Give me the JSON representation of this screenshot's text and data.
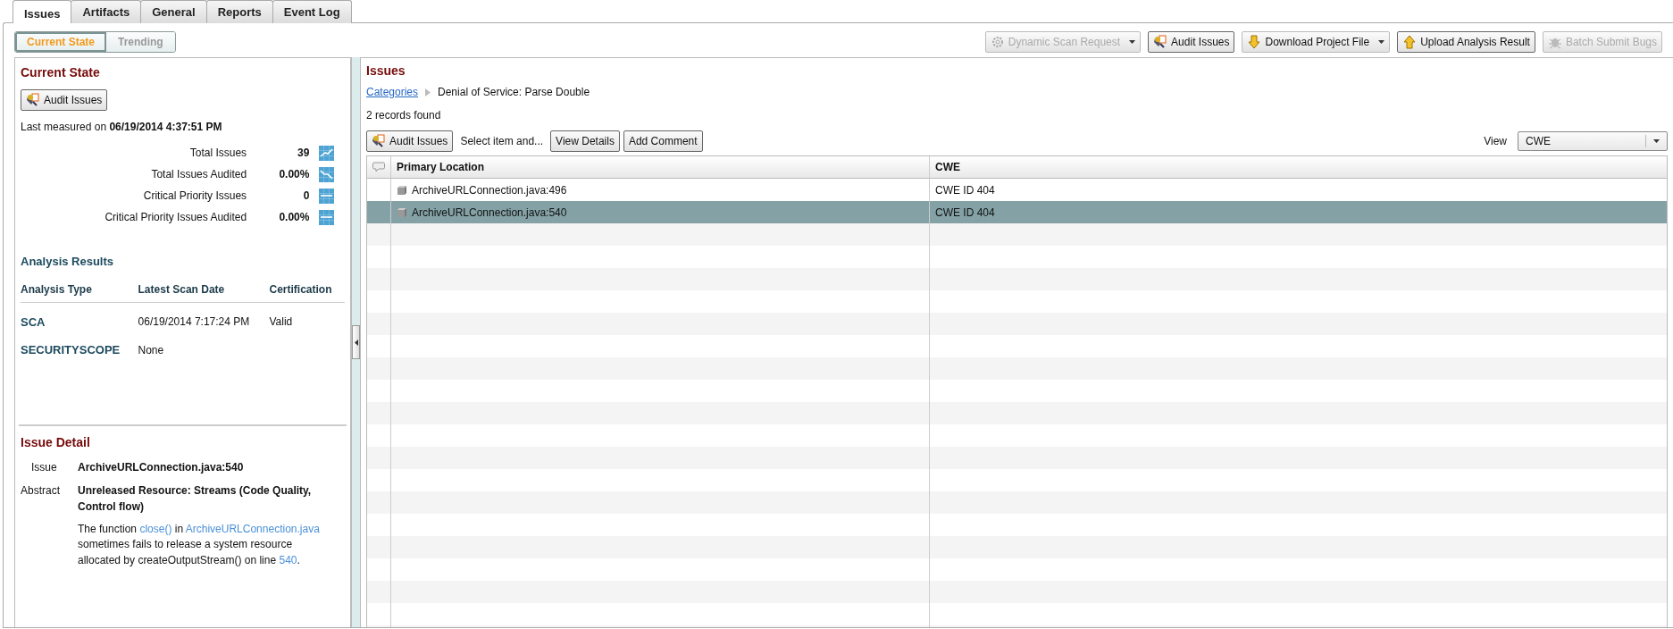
{
  "tabs": [
    {
      "label": "Issues",
      "selected": true
    },
    {
      "label": "Artifacts",
      "selected": false
    },
    {
      "label": "General",
      "selected": false
    },
    {
      "label": "Reports",
      "selected": false
    },
    {
      "label": "Event Log",
      "selected": false
    }
  ],
  "view_toggle": [
    {
      "label": "Current State",
      "selected": true
    },
    {
      "label": "Trending",
      "selected": false
    }
  ],
  "toolbar": [
    {
      "kind": "gear",
      "label": "Dynamic Scan Request",
      "disabled": true,
      "dropdown": true
    },
    {
      "kind": "audit",
      "label": "Audit Issues",
      "disabled": false,
      "dropdown": false
    },
    {
      "kind": "download",
      "label": "Download Project File",
      "disabled": false,
      "dropdown": true
    },
    {
      "kind": "upload",
      "label": "Upload Analysis Result",
      "disabled": false,
      "dropdown": false
    },
    {
      "kind": "bug",
      "label": "Batch Submit Bugs",
      "disabled": true,
      "dropdown": false
    }
  ],
  "current_state": {
    "title": "Current State",
    "audit_button": "Audit Issues",
    "last_measured": "Last measured on **06/19/2014 4:37:51 PM**",
    "metrics": [
      {
        "label": "Total Issues",
        "value": "39",
        "kind": "up"
      },
      {
        "label": "Total Issues Audited",
        "value": "0.00%",
        "kind": "down"
      },
      {
        "label": "Critical Priority Issues",
        "value": "0",
        "kind": "flat"
      },
      {
        "label": "Critical Priority Issues Audited",
        "value": "0.00%",
        "kind": "flat"
      }
    ]
  },
  "analysis_results": {
    "title": "Analysis Results",
    "columns": [
      "Analysis Type",
      "Latest Scan Date",
      "Certification"
    ],
    "rows": [
      [
        "SCA",
        "06/19/2014 7:17:24 PM",
        "Valid"
      ],
      [
        "SECURITYSCOPE",
        "None"
      ]
    ]
  },
  "issue_detail": {
    "title": "Issue Detail",
    "issue_label": "Issue",
    "issue": "ArchiveURLConnection.java:540",
    "abstract_label": "Abstract",
    "abstract": "Unreleased Resource: Streams (Code Quality, Control flow)",
    "description": [
      {
        "text": "The function ",
        "link": false
      },
      {
        "text": "close()",
        "link": true
      },
      {
        "text": " in ",
        "link": false
      },
      {
        "text": "ArchiveURLConnection.java",
        "link": true
      },
      {
        "text": " sometimes fails to release a system resource allocated by createOutputStream() on line ",
        "link": false
      },
      {
        "text": "540",
        "link": true
      },
      {
        "text": ".",
        "link": false
      }
    ]
  },
  "issues": {
    "title": "Issues",
    "breadcrumb": {
      "link": "Categories",
      "current": "Denial of Service: Parse Double"
    },
    "count": "2 records found",
    "audit_button": "Audit Issues",
    "hint": "Select item and...",
    "buttons": [
      "View Details",
      "Add Comment"
    ],
    "view": {
      "label": "View",
      "value": "CWE"
    },
    "columns": [
      "Primary Location",
      "CWE"
    ],
    "rows": [
      {
        "cells": [
          "ArchiveURLConnection.java:496",
          "CWE ID 404"
        ],
        "selected": false
      },
      {
        "cells": [
          "ArchiveURLConnection.java:540",
          "CWE ID 404"
        ],
        "selected": true
      }
    ]
  }
}
